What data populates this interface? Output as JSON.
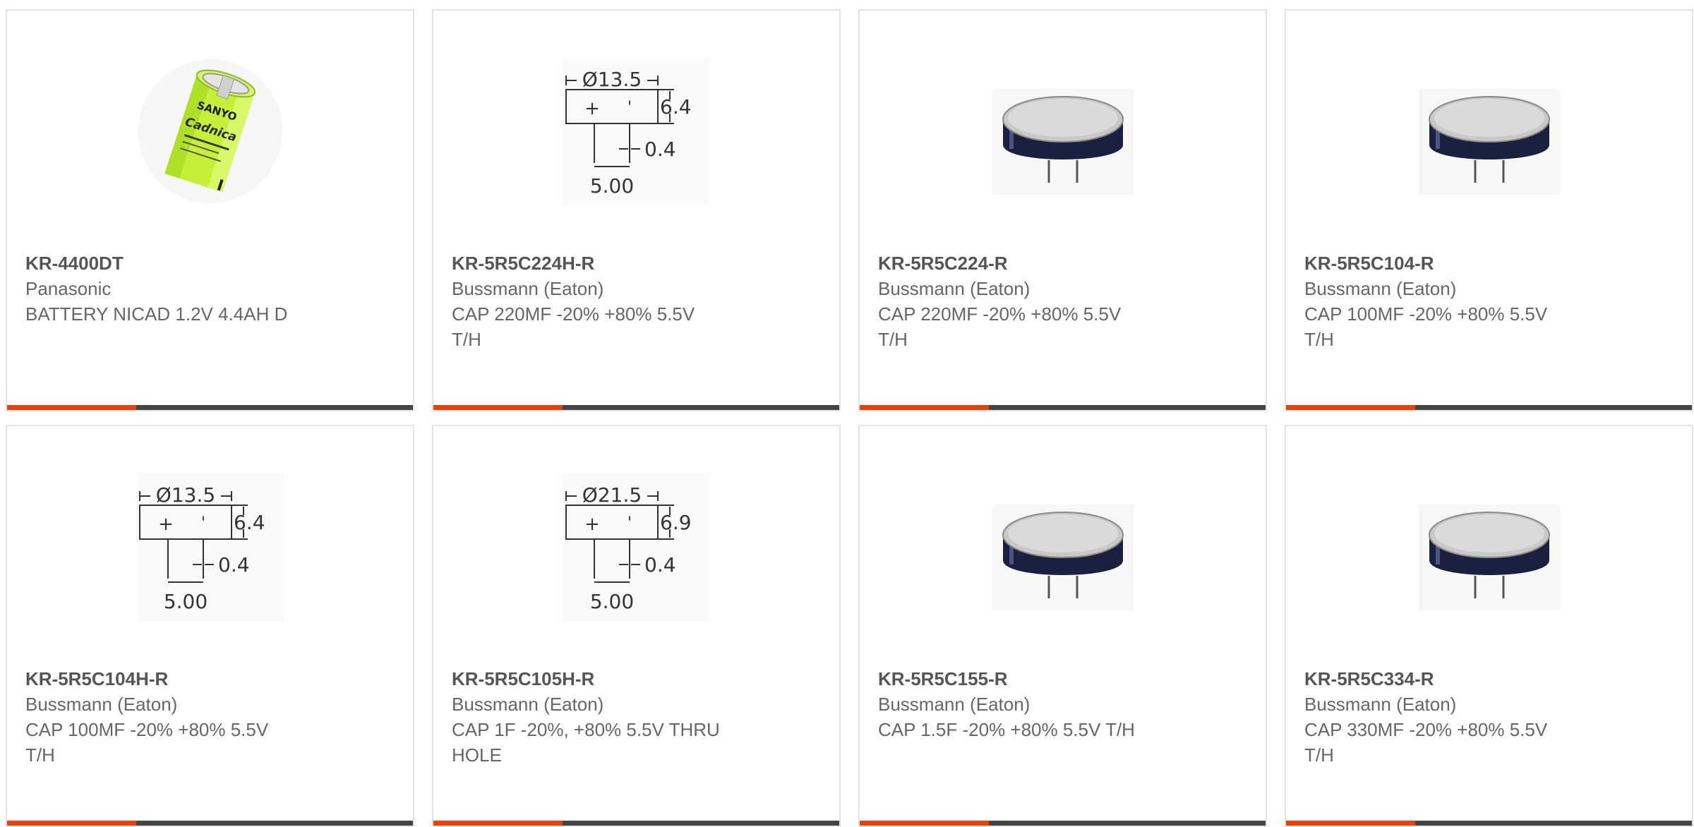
{
  "colors": {
    "accent_orange": "#e8420c",
    "accent_dark": "#444444",
    "card_border": "#e3e3e3",
    "text": "#666666"
  },
  "products": [
    {
      "part_number": "KR-4400DT",
      "manufacturer": "Panasonic",
      "description": "BATTERY NICAD 1.2V 4.4AH D",
      "image": "battery-image"
    },
    {
      "part_number": "KR-5R5C224H-R",
      "manufacturer": "Bussmann (Eaton)",
      "description": "CAP 220MF -20% +80% 5.5V\nT/H",
      "image": "dimension-drawing",
      "drawing": {
        "diameter": "Ø13.5",
        "height": "6.4",
        "lead": "0.4",
        "pitch": "5.00"
      }
    },
    {
      "part_number": "KR-5R5C224-R",
      "manufacturer": "Bussmann (Eaton)",
      "description": "CAP 220MF -20% +80% 5.5V\nT/H",
      "image": "supercapacitor-image"
    },
    {
      "part_number": "KR-5R5C104-R",
      "manufacturer": "Bussmann (Eaton)",
      "description": "CAP 100MF -20% +80% 5.5V\nT/H",
      "image": "supercapacitor-image"
    },
    {
      "part_number": "KR-5R5C104H-R",
      "manufacturer": "Bussmann (Eaton)",
      "description": "CAP 100MF -20% +80% 5.5V\nT/H",
      "image": "dimension-drawing",
      "drawing": {
        "diameter": "Ø13.5",
        "height": "6.4",
        "lead": "0.4",
        "pitch": "5.00"
      }
    },
    {
      "part_number": "KR-5R5C105H-R",
      "manufacturer": "Bussmann (Eaton)",
      "description": "CAP 1F -20%, +80% 5.5V THRU\nHOLE",
      "image": "dimension-drawing",
      "drawing": {
        "diameter": "Ø21.5",
        "height": "6.9",
        "lead": "0.4",
        "pitch": "5.00"
      }
    },
    {
      "part_number": "KR-5R5C155-R",
      "manufacturer": "Bussmann (Eaton)",
      "description": "CAP 1.5F -20% +80% 5.5V T/H",
      "image": "supercapacitor-image"
    },
    {
      "part_number": "KR-5R5C334-R",
      "manufacturer": "Bussmann (Eaton)",
      "description": "CAP 330MF -20% +80% 5.5V\nT/H",
      "image": "supercapacitor-image"
    }
  ]
}
